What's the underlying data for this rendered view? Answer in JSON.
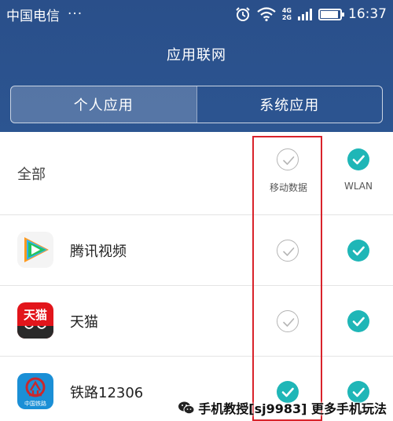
{
  "status_bar": {
    "carrier": "中国电信",
    "more": "···",
    "network_top": "4G",
    "network_bottom": "2G",
    "battery_level": 0.9,
    "time": "16:37"
  },
  "header": {
    "title": "应用联网",
    "tabs": [
      {
        "label": "个人应用",
        "active": true
      },
      {
        "label": "系统应用",
        "active": false
      }
    ]
  },
  "columns": {
    "mobile_data": "移动数据",
    "wlan": "WLAN"
  },
  "rows": [
    {
      "label": "全部",
      "mobile_data": false,
      "wlan": true
    },
    {
      "label": "腾讯视频",
      "icon": "tencent-video-icon",
      "mobile_data": false,
      "wlan": true
    },
    {
      "label": "天猫",
      "icon": "tmall-icon",
      "icon_text": "天猫",
      "mobile_data": false,
      "wlan": true
    },
    {
      "label": "铁路12306",
      "icon": "railway-12306-icon",
      "icon_text": "中国铁路",
      "mobile_data": true,
      "wlan": true
    }
  ],
  "colors": {
    "header": "#2a4f8a",
    "check_on": "#1fb6b7",
    "highlight": "#d9232b"
  },
  "watermark": {
    "text": "手机教授[sj9983] 更多手机玩法"
  }
}
